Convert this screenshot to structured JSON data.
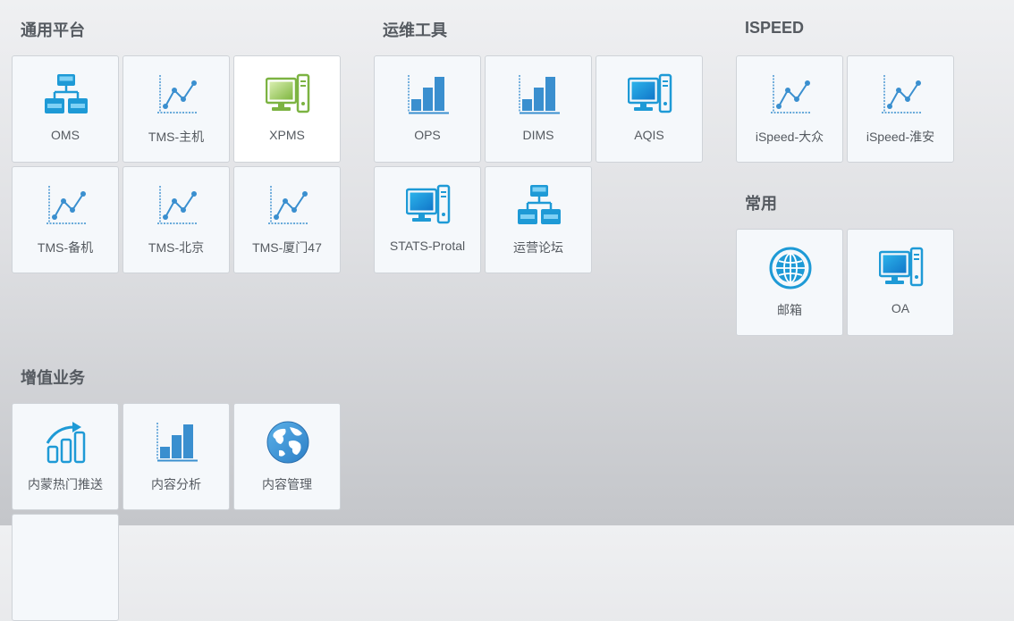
{
  "sections": {
    "general": {
      "title": "通用平台",
      "tiles": [
        {
          "label": "OMS",
          "icon": "network-hierarchy-icon"
        },
        {
          "label": "TMS-主机",
          "icon": "line-chart-icon"
        },
        {
          "label": "XPMS",
          "icon": "desktop-computer-icon"
        },
        {
          "label": "TMS-备机",
          "icon": "line-chart-icon"
        },
        {
          "label": "TMS-北京",
          "icon": "line-chart-icon"
        },
        {
          "label": "TMS-厦门47",
          "icon": "line-chart-icon"
        }
      ]
    },
    "ops": {
      "title": "运维工具",
      "tiles": [
        {
          "label": "OPS",
          "icon": "bar-chart-icon"
        },
        {
          "label": "DIMS",
          "icon": "bar-chart-icon"
        },
        {
          "label": "AQIS",
          "icon": "desktop-computer-icon"
        },
        {
          "label": "STATS-Protal",
          "icon": "desktop-computer-icon"
        },
        {
          "label": "运营论坛",
          "icon": "network-hierarchy-icon"
        }
      ]
    },
    "ispeed": {
      "title": "ISPEED",
      "tiles": [
        {
          "label": "iSpeed-大众",
          "icon": "line-chart-icon"
        },
        {
          "label": "iSpeed-淮安",
          "icon": "line-chart-icon"
        }
      ]
    },
    "common": {
      "title": "常用",
      "tiles": [
        {
          "label": "邮箱",
          "icon": "globe-icon"
        },
        {
          "label": "OA",
          "icon": "desktop-computer-icon"
        }
      ]
    },
    "value_added": {
      "title": "增值业务",
      "tiles": [
        {
          "label": "内蒙热门推送",
          "icon": "trending-up-icon"
        },
        {
          "label": "内容分析",
          "icon": "bar-chart-icon"
        },
        {
          "label": "内容管理",
          "icon": "earth-icon"
        }
      ]
    }
  },
  "colors": {
    "icon_blue": "#1e9ad6",
    "icon_green": "#7cb342",
    "text": "#555a60"
  }
}
